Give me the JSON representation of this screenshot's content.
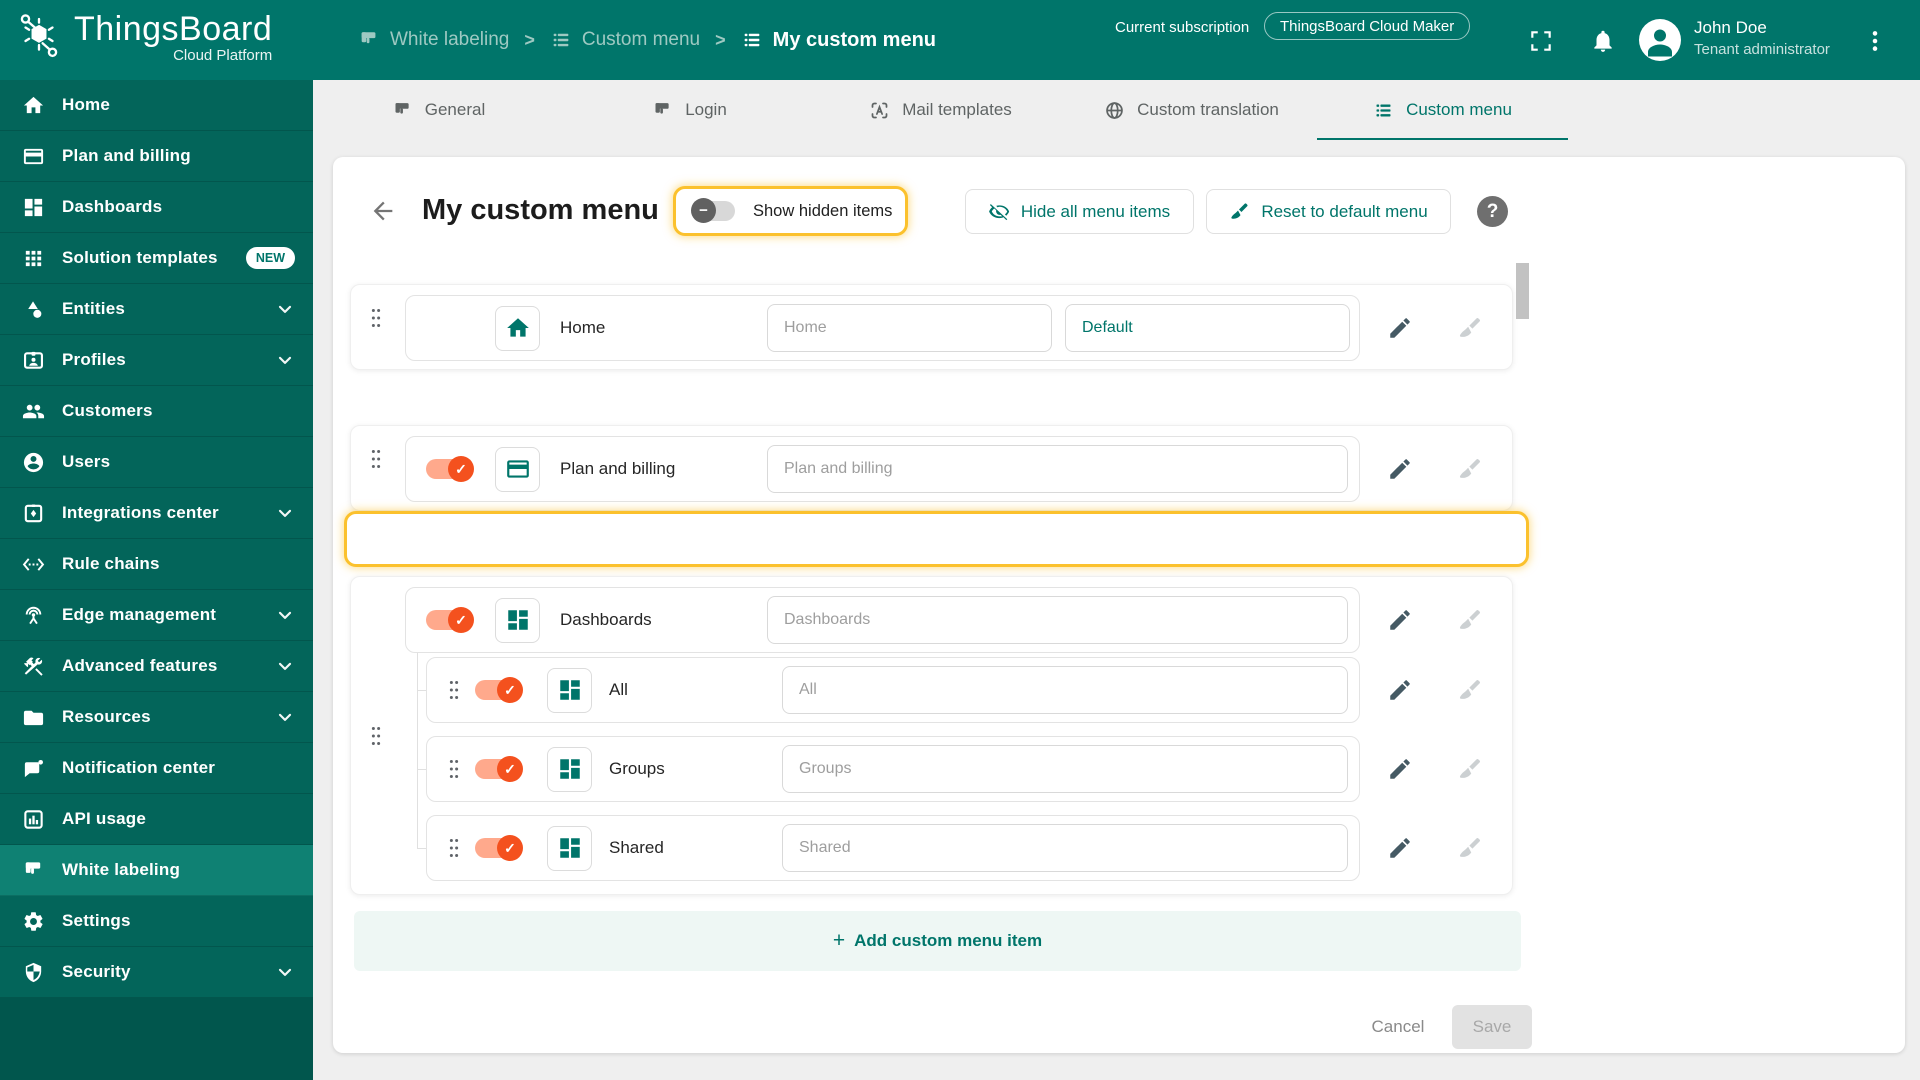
{
  "colors": {
    "accent": "#00756A",
    "toggle_on": "#F4511E",
    "highlight": "#FBC12D"
  },
  "ui": {
    "check": "✓",
    "minus": "−",
    "plus": "+",
    "help": "?",
    "separator": ">"
  },
  "header": {
    "product": "ThingsBoard",
    "product_sub": "Cloud Platform",
    "breadcrumb": [
      {
        "label": "White labeling",
        "icon": "flag-icon"
      },
      {
        "label": "Custom menu",
        "icon": "list-icon",
        "sep": ">"
      },
      {
        "label": "My custom menu",
        "icon": "list-icon",
        "sep": ">",
        "active": true
      }
    ],
    "subscription_label": "Current subscription",
    "subscription_value": "ThingsBoard Cloud Maker",
    "user_name": "John Doe",
    "user_role": "Tenant administrator"
  },
  "sidebar": {
    "items": [
      {
        "label": "Home",
        "icon": "home-icon"
      },
      {
        "label": "Plan and billing",
        "icon": "credit-card-icon"
      },
      {
        "label": "Dashboards",
        "icon": "dashboards-icon"
      },
      {
        "label": "Solution templates",
        "icon": "grid-icon",
        "badge": "NEW"
      },
      {
        "label": "Entities",
        "icon": "shapes-icon",
        "expandable": true
      },
      {
        "label": "Profiles",
        "icon": "badge-icon",
        "expandable": true
      },
      {
        "label": "Customers",
        "icon": "people-icon"
      },
      {
        "label": "Users",
        "icon": "user-icon"
      },
      {
        "label": "Integrations center",
        "icon": "integration-icon",
        "expandable": true
      },
      {
        "label": "Rule chains",
        "icon": "rule-chain-icon"
      },
      {
        "label": "Edge management",
        "icon": "edge-icon",
        "expandable": true
      },
      {
        "label": "Advanced features",
        "icon": "tools-icon",
        "expandable": true
      },
      {
        "label": "Resources",
        "icon": "folder-icon",
        "expandable": true
      },
      {
        "label": "Notification center",
        "icon": "notification-icon"
      },
      {
        "label": "API usage",
        "icon": "api-usage-icon"
      },
      {
        "label": "White labeling",
        "icon": "flag-icon",
        "active": true
      },
      {
        "label": "Settings",
        "icon": "settings-icon"
      },
      {
        "label": "Security",
        "icon": "security-icon",
        "expandable": true
      }
    ]
  },
  "tabs": [
    {
      "label": "General",
      "icon": "flag-icon"
    },
    {
      "label": "Login",
      "icon": "flag-icon"
    },
    {
      "label": "Mail templates",
      "icon": "mail-template-icon"
    },
    {
      "label": "Custom translation",
      "icon": "globe-icon"
    },
    {
      "label": "Custom menu",
      "icon": "list-icon",
      "active": true
    }
  ],
  "toolbar": {
    "title": "My custom menu",
    "show_hidden_label": "Show hidden items",
    "hide_all_label": "Hide all menu items",
    "reset_label": "Reset to default menu"
  },
  "menu": {
    "home": {
      "label": "Home",
      "placeholder": "Home",
      "page_type": "Default",
      "icon": "home-icon"
    },
    "plan": {
      "label": "Plan and billing",
      "placeholder": "Plan and billing",
      "icon": "credit-card-icon"
    },
    "dashboards": {
      "label": "Dashboards",
      "placeholder": "Dashboards",
      "icon": "dashboards-icon",
      "children": [
        {
          "label": "All",
          "placeholder": "All",
          "icon": "dashboards-icon"
        },
        {
          "label": "Groups",
          "placeholder": "Groups",
          "icon": "dashboards-icon"
        },
        {
          "label": "Shared",
          "placeholder": "Shared",
          "icon": "dashboards-icon"
        }
      ]
    }
  },
  "footer": {
    "add_label": "Add custom menu item",
    "cancel_label": "Cancel",
    "save_label": "Save"
  }
}
